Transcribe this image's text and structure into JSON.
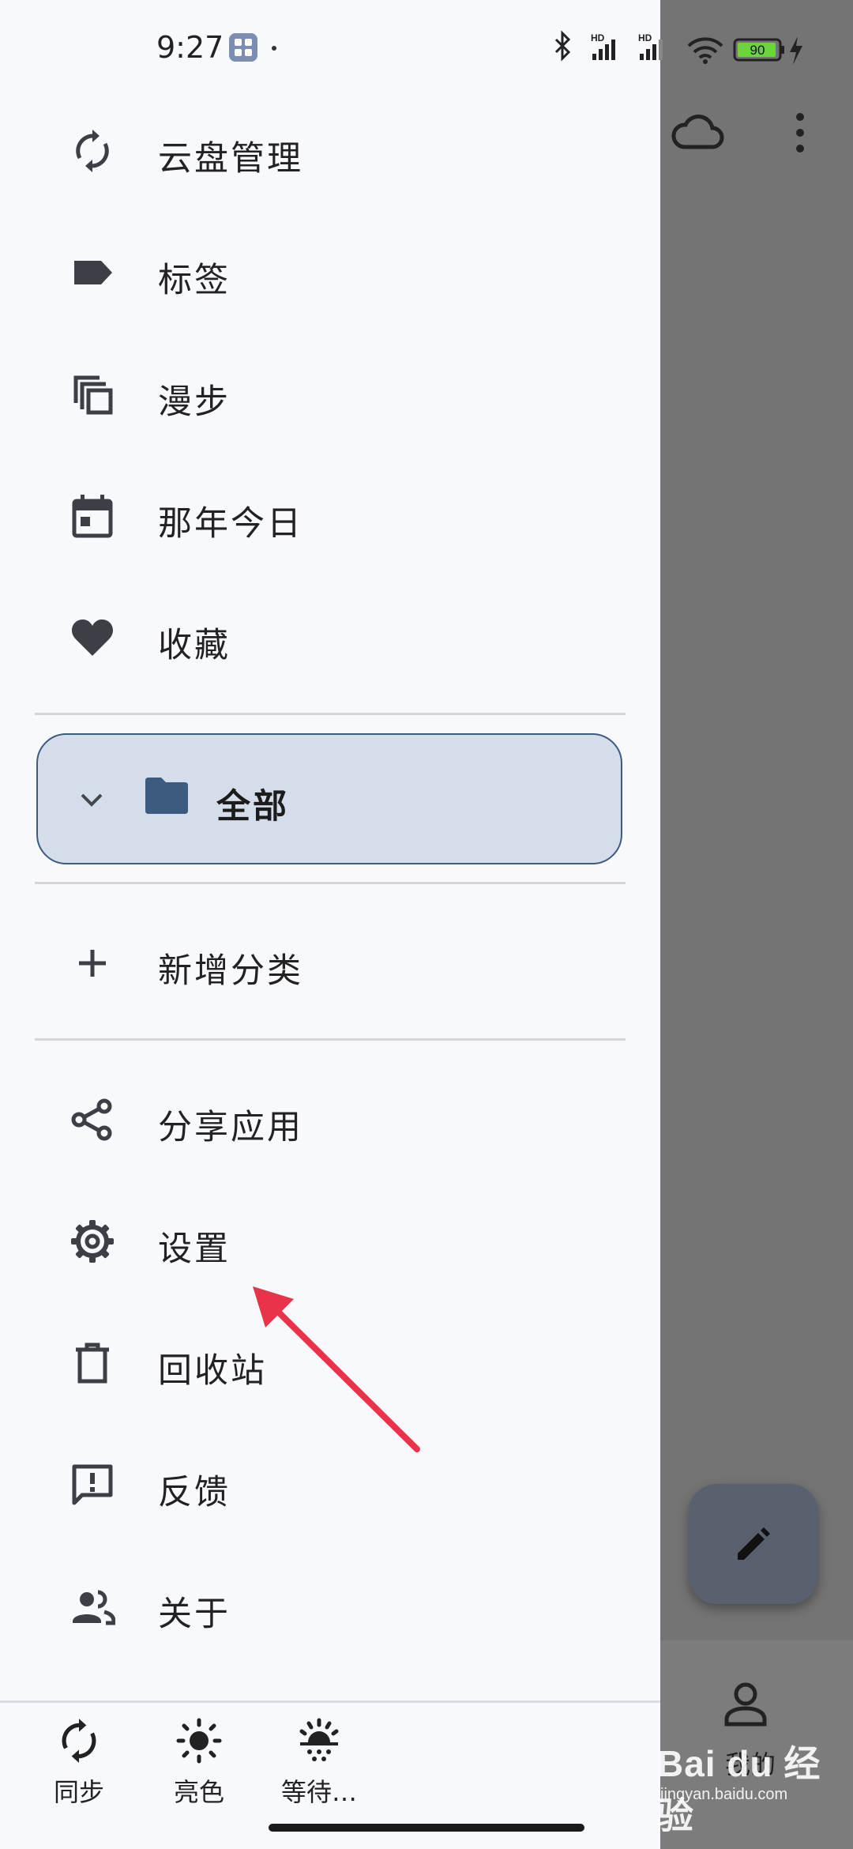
{
  "status_bar": {
    "time": "9:27",
    "battery": "90",
    "network_badge_1": "HD",
    "network_badge_2": "HD"
  },
  "drawer": {
    "items_top": [
      {
        "label": "云盘管理",
        "icon": "sync-icon"
      },
      {
        "label": "标签",
        "icon": "label-icon"
      },
      {
        "label": "漫步",
        "icon": "copy-icon"
      },
      {
        "label": "那年今日",
        "icon": "calendar-icon"
      },
      {
        "label": "收藏",
        "icon": "heart-icon"
      }
    ],
    "folder": {
      "label": "全部",
      "icon": "folder-icon"
    },
    "add_category": {
      "label": "新增分类",
      "icon": "plus-icon"
    },
    "items_bottom": [
      {
        "label": "分享应用",
        "icon": "share-icon"
      },
      {
        "label": "设置",
        "icon": "gear-icon"
      },
      {
        "label": "回收站",
        "icon": "trash-icon"
      },
      {
        "label": "反馈",
        "icon": "feedback-icon"
      },
      {
        "label": "关于",
        "icon": "people-icon"
      }
    ],
    "bottom_bar": [
      {
        "label": "同步",
        "icon": "sync-icon"
      },
      {
        "label": "亮色",
        "icon": "sun-icon"
      },
      {
        "label": "等待…",
        "icon": "sunrise-icon"
      }
    ]
  },
  "background_app": {
    "profile_label": "我的"
  },
  "watermark": {
    "main": "Bai du 经验",
    "sub": "jingyan.baidu.com"
  },
  "colors": {
    "accent": "#3d5a80",
    "folder_fill": "#d4ddea",
    "arrow": "#e8334a",
    "drawer_bg": "#f8f9fd",
    "scrim": "#747474"
  }
}
